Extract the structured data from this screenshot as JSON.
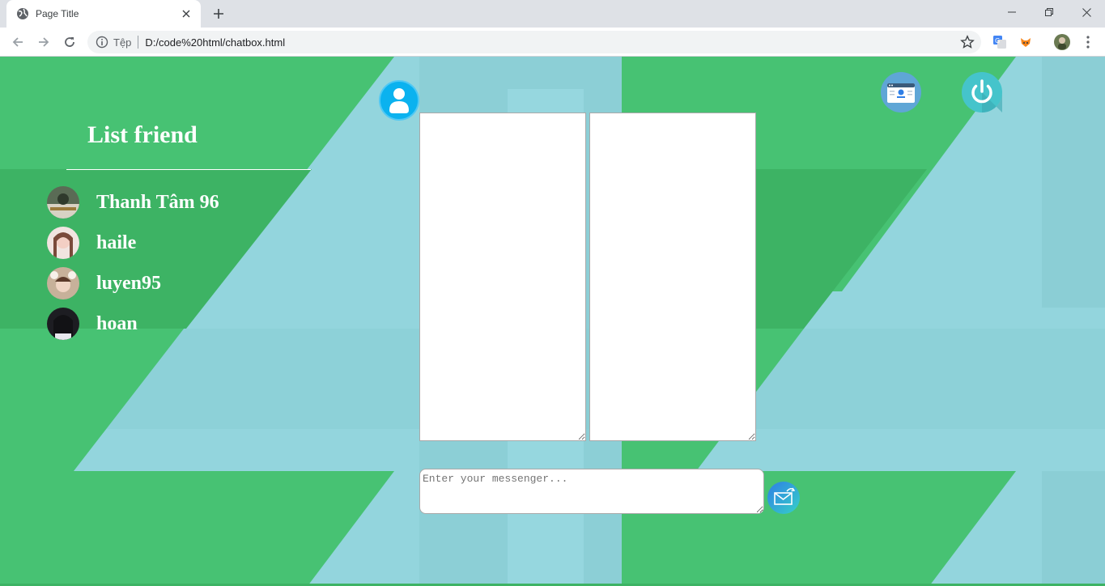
{
  "browser": {
    "tab_title": "Page Title",
    "address_scheme_label": "Tệp",
    "address_url": "D:/code%20html/chatbox.html"
  },
  "sidebar": {
    "title": "List friend",
    "friends": [
      {
        "name": "Thanh Tâm 96"
      },
      {
        "name": "haile"
      },
      {
        "name": "luyen95"
      },
      {
        "name": "hoan"
      }
    ]
  },
  "chat": {
    "message_placeholder": "Enter your messenger..."
  },
  "colors": {
    "green": "#47c273",
    "dark_green": "#3db364",
    "light_blue": "#93d5dd",
    "profile_blue": "#0bb2ef",
    "power_teal": "#45c4cb"
  }
}
